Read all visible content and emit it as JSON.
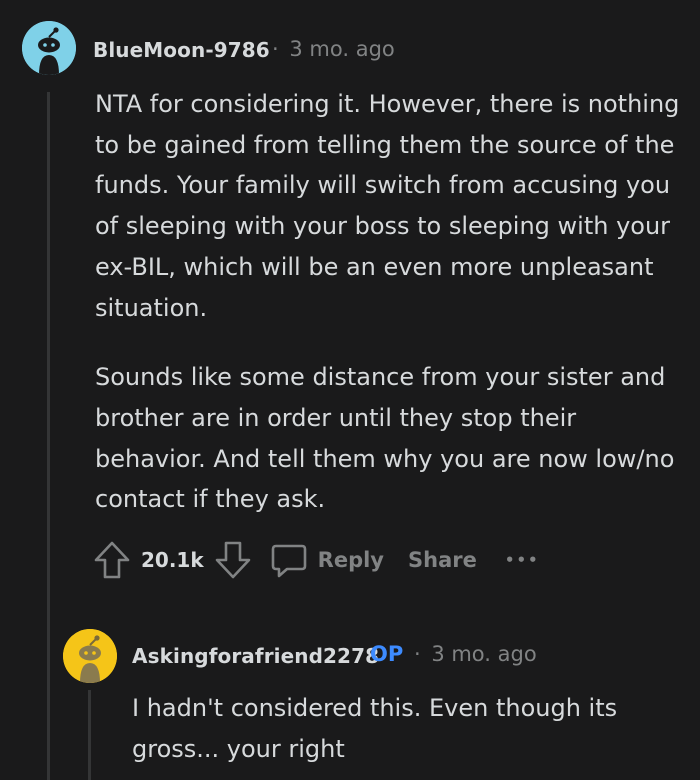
{
  "comments": [
    {
      "username": "BlueMoon-9786",
      "separator": "·",
      "time": "3 mo. ago",
      "paragraphs": [
        "NTA for considering it. However, there is nothing to be gained from telling them the source of the funds. Your family will switch from accusing you of sleeping with your boss to sleeping with your ex-BIL, which will be an even more unpleasant situation.",
        "Sounds like some distance from your sister and brother are in order until they stop their behavior. And tell them why you are now low/no contact if they ask."
      ],
      "vote_count": "20.1k",
      "reply_label": "Reply",
      "share_label": "Share",
      "more_label": "•••",
      "avatar_color": "#7fd1e8"
    },
    {
      "username": "Askingforafriend2278",
      "op_badge": "OP",
      "separator": "·",
      "time": "3 mo. ago",
      "paragraphs": [
        "I hadn't considered this. Even though its gross... your right"
      ],
      "avatar_color": "#f5c518"
    }
  ],
  "icons": {
    "upvote": "upvote-arrow-icon",
    "downvote": "downvote-arrow-icon",
    "reply": "speech-bubble-icon",
    "avatar": "snoo-avatar-icon"
  },
  "colors": {
    "background": "#1a1a1b",
    "text": "#d7dadc",
    "muted": "#818384",
    "op": "#3d8bff",
    "thread_line": "#343536"
  }
}
